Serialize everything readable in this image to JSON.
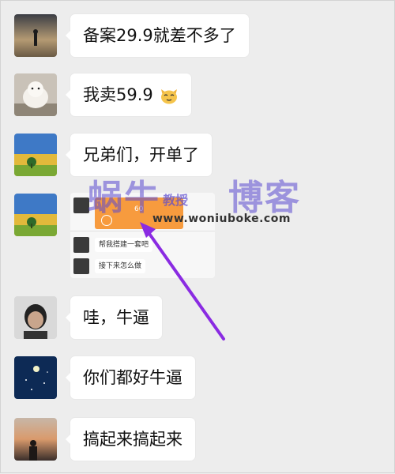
{
  "messages": [
    {
      "text": "备案29.9就差不多了",
      "avatar": "silhouette-sunset-avatar"
    },
    {
      "text": "我卖59.9",
      "emoji": "cat-face-icon",
      "avatar": "white-dog-avatar"
    },
    {
      "text": "兄弟们，开单了",
      "avatar": "field-tree-avatar"
    },
    {
      "avatar": "field-tree-avatar"
    },
    {
      "text": "哇，牛逼",
      "avatar": "child-portrait-avatar"
    },
    {
      "text": "你们都好牛逼",
      "avatar": "night-sky-avatar"
    },
    {
      "text": "搞起来搞起来",
      "avatar": "sunset-person-avatar"
    }
  ],
  "card": {
    "row1_text": "帮我搭建一套吧",
    "row2_text": "接下来怎么做",
    "order_amount": "60"
  },
  "watermark": {
    "brand": "蜗牛",
    "middle": "教授",
    "brand2": "博客",
    "url": "www.woniuboke.com"
  },
  "colors": {
    "background": "#ededed",
    "bubble": "#ffffff",
    "arrow": "#8a2be2",
    "orange": "#f79b3e"
  }
}
